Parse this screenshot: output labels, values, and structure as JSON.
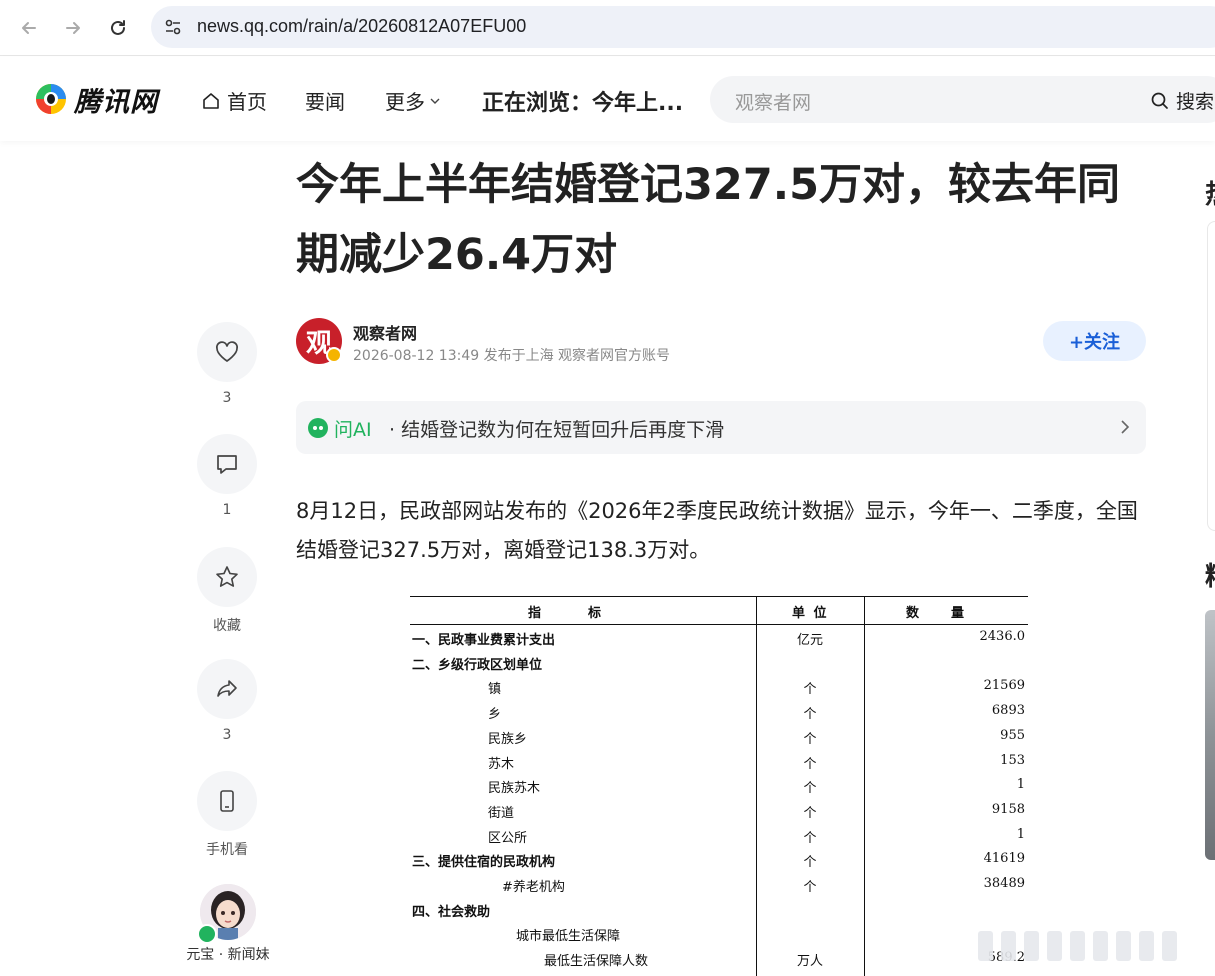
{
  "browser": {
    "url": "news.qq.com/rain/a/20260812A07EFU00"
  },
  "header": {
    "logo_text": "腾讯网",
    "nav": {
      "home": "首页",
      "news": "要闻",
      "more": "更多"
    },
    "browsing": "正在浏览：今年上...",
    "search_placeholder": "观察者网",
    "search_button": "搜索"
  },
  "article": {
    "title": "今年上半年结婚登记327.5万对，较去年同期减少26.4万对",
    "author": {
      "avatar_char": "观",
      "name": "观察者网",
      "meta": "2026-08-12 13:49 发布于上海 观察者网官方账号"
    },
    "follow_label": "+关注",
    "ai": {
      "label": "问AI",
      "question": " · 结婚登记数为何在短暂回升后再度下滑"
    },
    "paragraph": "8月12日，民政部网站发布的《2026年2季度民政统计数据》显示，今年一、二季度，全国结婚登记327.5万对，离婚登记138.3万对。"
  },
  "stats_table": {
    "headers": {
      "indicator": "指　　　标",
      "unit": "单 位",
      "quantity": "数　　量"
    },
    "rows": [
      {
        "name": "一、民政事业费累计支出",
        "unit": "亿元",
        "value": "2436.0",
        "bold": true
      },
      {
        "name": "二、乡级行政区划单位",
        "unit": "",
        "value": "",
        "bold": true
      },
      {
        "name": "镇",
        "unit": "个",
        "value": "21569",
        "bold": false
      },
      {
        "name": "乡",
        "unit": "个",
        "value": "6893",
        "bold": false
      },
      {
        "name": "民族乡",
        "unit": "个",
        "value": "955",
        "bold": false
      },
      {
        "name": "苏木",
        "unit": "个",
        "value": "153",
        "bold": false
      },
      {
        "name": "民族苏木",
        "unit": "个",
        "value": "1",
        "bold": false
      },
      {
        "name": "街道",
        "unit": "个",
        "value": "9158",
        "bold": false
      },
      {
        "name": "区公所",
        "unit": "个",
        "value": "1",
        "bold": false
      },
      {
        "name": "三、提供住宿的民政机构",
        "unit": "个",
        "value": "41619",
        "bold": true
      },
      {
        "name": "#养老机构",
        "unit": "个",
        "value": "38489",
        "bold": false
      },
      {
        "name": "四、社会救助",
        "unit": "",
        "value": "",
        "bold": true
      },
      {
        "name": "城市最低生活保障",
        "unit": "",
        "value": "",
        "bold": false
      },
      {
        "name": "最低生活保障人数",
        "unit": "万人",
        "value": "589.2",
        "bold": false
      }
    ]
  },
  "rail": {
    "like_count": "3",
    "comment_count": "1",
    "favorite_label": "收藏",
    "share_count": "3",
    "mobile_label": "手机看",
    "assistant_label": "元宝 · 新闻妹"
  },
  "right": {
    "peek1": "热",
    "peek2": "精"
  }
}
